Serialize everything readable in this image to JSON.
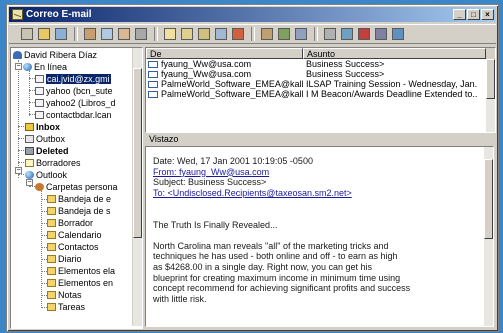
{
  "window": {
    "title": "Correo E-mail"
  },
  "titlebar_buttons": [
    "_",
    "□",
    "×"
  ],
  "tree": {
    "items": [
      {
        "label": "David Ribera Díaz",
        "icon": "user-icon"
      },
      {
        "label": "En línea",
        "icon": "globe-icon"
      },
      {
        "label": "cai.jvid@zx.gmi",
        "icon": "mail-icon",
        "selected": true
      },
      {
        "label": "yahoo (bcn_sute",
        "icon": "mail-icon"
      },
      {
        "label": "yahoo2 (Libros_d",
        "icon": "mail-icon"
      },
      {
        "label": "contactbdar.lcan",
        "icon": "mail-icon"
      },
      {
        "label": "Inbox",
        "icon": "inbox-icon",
        "bold": true
      },
      {
        "label": "Outbox",
        "icon": "outbox-icon"
      },
      {
        "label": "Deleted",
        "icon": "trash-icon",
        "bold": true
      },
      {
        "label": "Borradores",
        "icon": "drafts-icon"
      },
      {
        "label": "Outlook",
        "icon": "globe-icon"
      },
      {
        "label": "Carpetas persona",
        "icon": "people-icon"
      },
      {
        "label": "Bandeja de e",
        "icon": "folder-icon"
      },
      {
        "label": "Bandeja de s",
        "icon": "folder-icon"
      },
      {
        "label": "Borrador",
        "icon": "folder-icon"
      },
      {
        "label": "Calendario",
        "icon": "folder-icon"
      },
      {
        "label": "Contactos",
        "icon": "folder-icon"
      },
      {
        "label": "Diario",
        "icon": "folder-icon"
      },
      {
        "label": "Elementos ela",
        "icon": "folder-icon"
      },
      {
        "label": "Elementos en",
        "icon": "folder-icon"
      },
      {
        "label": "Notas",
        "icon": "folder-icon"
      },
      {
        "label": "Tareas",
        "icon": "folder-icon"
      }
    ]
  },
  "list": {
    "headers": {
      "from": "De",
      "subject": "Asunto"
    },
    "rows": [
      {
        "from": "fyaung_Ww@usa.com",
        "subject": "Business Success>"
      },
      {
        "from": "fyaung_Ww@usa.com",
        "subject": "Business Success>"
      },
      {
        "from": "PalmeWorld_Software_EMEA@kall...",
        "subject": "ILSAP Training Session - Wednesday, Jan..."
      },
      {
        "from": "PalmeWorld_Software_EMEA@kall...",
        "subject": "I M Beacon/Awards Deadline Extended to..."
      }
    ]
  },
  "preview": {
    "label": "Vistazo",
    "lines": [
      "Date: Wed, 17 Jan 2001 10:19:05 -0500",
      "From: fyaung_Ww@usa.com",
      "Subject: Business Success>",
      "To: <Undisclosed.Recipients@taxeosan.sm2.net>",
      "",
      "",
      "The Truth Is Finally Revealed...",
      "",
      "North Carolina man reveals \"all\" of the marketing tricks and",
      "techniques he has used - both online and off - to earn as high",
      "as $4268.00 in a single day. Right now, you can get his",
      "blueprint for creating maximum income in minimum time using",
      "concept recommend for achieving significant profits and success",
      "with little risk."
    ]
  },
  "toolbar_icons": [
    "new-mail-icon",
    "folder-open-icon",
    "address-book-icon",
    "send-receive-icon",
    "copy-icon",
    "move-icon",
    "print-icon",
    "reply-icon",
    "reply-all-icon",
    "forward-icon",
    "attach-icon",
    "flag-icon",
    "address-icon",
    "check-icon",
    "find-icon",
    "filter-icon",
    "move-to-folder-icon",
    "delete-icon",
    "options-icon",
    "help-icon"
  ]
}
